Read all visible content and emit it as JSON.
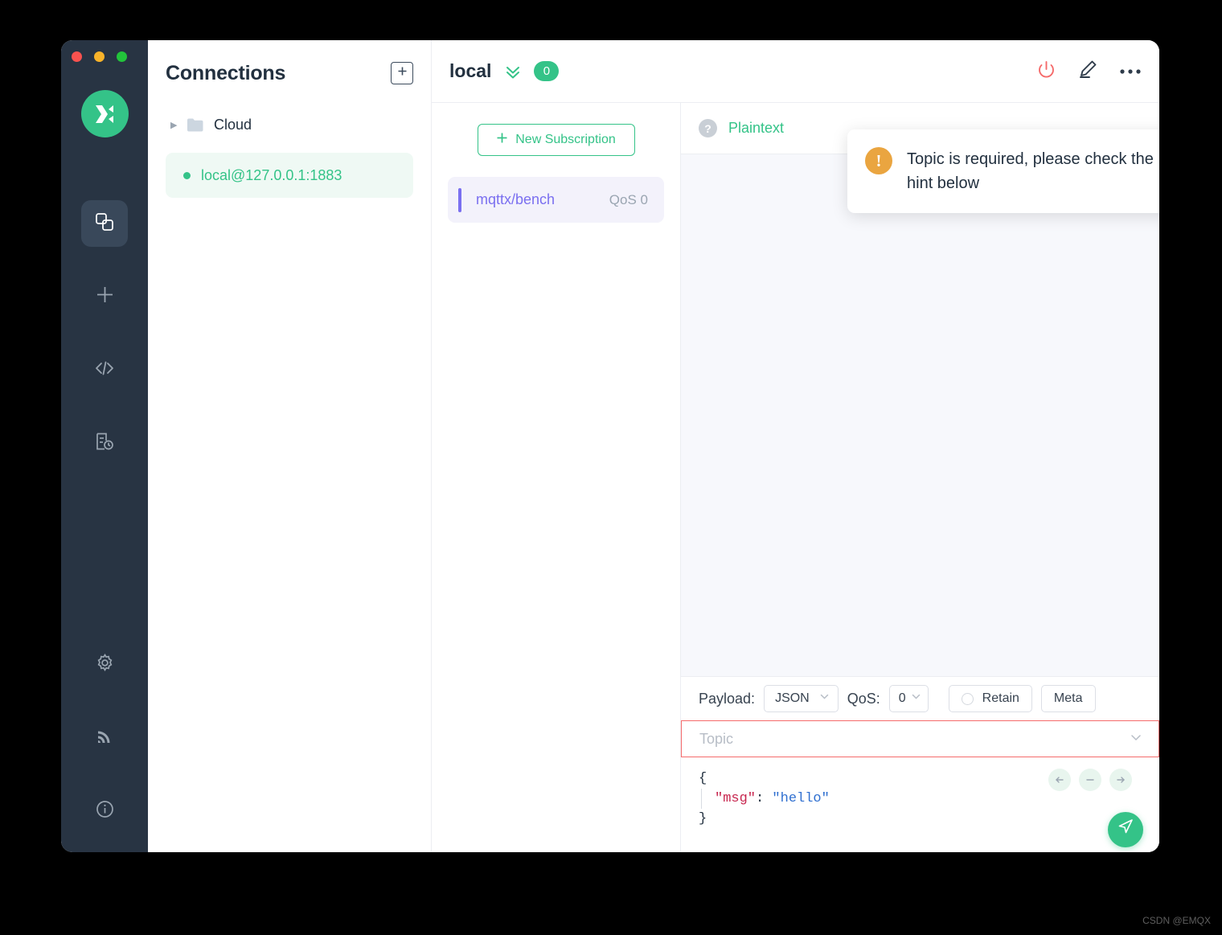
{
  "window": {
    "traffic_lights": [
      "close",
      "minimize",
      "maximize"
    ]
  },
  "rail": {
    "logo": "mqttx-logo",
    "top_items": [
      {
        "name": "connections",
        "icon": "overlapping-squares-icon",
        "active": true
      },
      {
        "name": "new-connection",
        "icon": "plus-icon",
        "active": false
      },
      {
        "name": "scripts",
        "icon": "code-brackets-icon",
        "active": false
      },
      {
        "name": "log",
        "icon": "document-clock-icon",
        "active": false
      }
    ],
    "bottom_items": [
      {
        "name": "settings",
        "icon": "gear-icon"
      },
      {
        "name": "broadcast",
        "icon": "signal-icon"
      },
      {
        "name": "about",
        "icon": "info-icon"
      }
    ]
  },
  "connections": {
    "title": "Connections",
    "add_button_icon": "plus-square-icon",
    "folder": {
      "label": "Cloud",
      "caret": "collapsed",
      "icon": "folder-icon"
    },
    "active_connection": {
      "label": "local@127.0.0.1:1883",
      "status": "connected",
      "status_color": "#34c388"
    }
  },
  "header": {
    "connection_name": "local",
    "collapse_icon": "double-chevron-down-icon",
    "message_count": "0",
    "badge_color": "#34c388",
    "actions": [
      {
        "name": "disconnect",
        "icon": "power-icon",
        "color": "#f56b6b"
      },
      {
        "name": "edit-connection",
        "icon": "pencil-icon",
        "color": "#22303f"
      },
      {
        "name": "more-options",
        "icon": "ellipsis-icon",
        "color": "#22303f"
      }
    ]
  },
  "subscriptions": {
    "new_subscription_label": "New Subscription",
    "new_subscription_icon": "plus-icon",
    "items": [
      {
        "topic": "mqttx/bench",
        "qos": "QoS 0",
        "color": "#7a6ff0"
      }
    ]
  },
  "format_bar": {
    "help_icon": "question-mark-icon",
    "format_label": "Plaintext"
  },
  "publish": {
    "payload_label": "Payload:",
    "payload_format": "JSON",
    "qos_label": "QoS:",
    "qos_value": "0",
    "retain_label": "Retain",
    "retain_checked": false,
    "meta_label": "Meta",
    "topic_placeholder": "Topic",
    "topic_value": "",
    "topic_error": true,
    "topic_border_color": "#f56b6b",
    "dropdown_icon": "chevron-down-icon",
    "editor": {
      "line1": "{",
      "line2_key": "\"msg\"",
      "line2_colon": ": ",
      "line2_value": "\"hello\"",
      "line3": "}"
    },
    "nav_buttons": [
      {
        "name": "prev",
        "icon": "arrow-left-icon"
      },
      {
        "name": "collapse",
        "icon": "minus-icon"
      },
      {
        "name": "next",
        "icon": "arrow-right-icon"
      }
    ],
    "send_icon": "paper-plane-icon",
    "send_color": "#34c388"
  },
  "toast": {
    "icon": "warning-exclamation-icon",
    "icon_color": "#eaa540",
    "message": "Topic is required, please check the hint below",
    "close_icon": "close-icon"
  },
  "watermark": {
    "text": "CSDN @EMQX"
  }
}
